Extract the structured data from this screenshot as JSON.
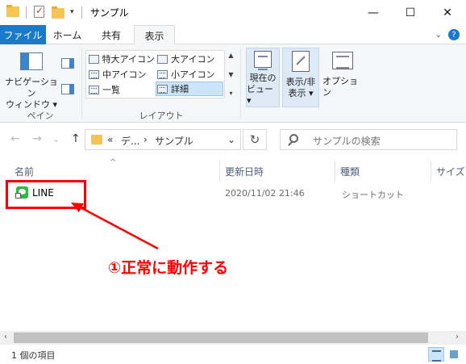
{
  "window": {
    "title": "サンプル",
    "minimize": "—",
    "maximize": "☐",
    "close": "✕"
  },
  "quick_access": {
    "dropdown": "▾"
  },
  "tabs": {
    "file": "ファイル",
    "home": "ホーム",
    "share": "共有",
    "view": "表示",
    "expand": "⌄",
    "help": "?"
  },
  "ribbon": {
    "pane_group": {
      "nav_pane_line1": "ナビゲーション",
      "nav_pane_line2": "ウィンドウ ▾",
      "label": "ペイン"
    },
    "layout_group": {
      "label": "レイアウト",
      "items": [
        "特大アイコン",
        "大アイコン",
        "中アイコン",
        "小アイコン",
        "一覧",
        "詳細"
      ],
      "selected": "詳細"
    },
    "current_view": {
      "line1": "現在の",
      "line2": "ビュー ▾"
    },
    "show_hide": {
      "line1": "表示/非",
      "line2": "表示 ▾"
    },
    "options": {
      "label": "オプション"
    }
  },
  "address": {
    "back": "←",
    "forward": "→",
    "recent": "⌄",
    "up": "↑",
    "overflow": "«",
    "crumb1": "デ...",
    "sep": "›",
    "crumb2": "サンプル",
    "dropdown": "⌄",
    "refresh": "↻"
  },
  "search": {
    "placeholder": "サンプルの検索"
  },
  "columns": {
    "name": "名前",
    "modified": "更新日時",
    "type": "種類",
    "size": "サイズ",
    "sort_indicator": "^"
  },
  "files": [
    {
      "name": "LINE",
      "modified": "2020/11/02 21:46",
      "type": "ショートカット"
    }
  ],
  "annotation": {
    "text": "①正常に動作する",
    "color": "#ff0000"
  },
  "scrollbar": {
    "left": "‹",
    "right": "›"
  },
  "status": {
    "item_count": "1 個の項目"
  },
  "colors": {
    "accent": "#1979ca",
    "line_green": "#2fb842",
    "folder": "#f5c453"
  }
}
